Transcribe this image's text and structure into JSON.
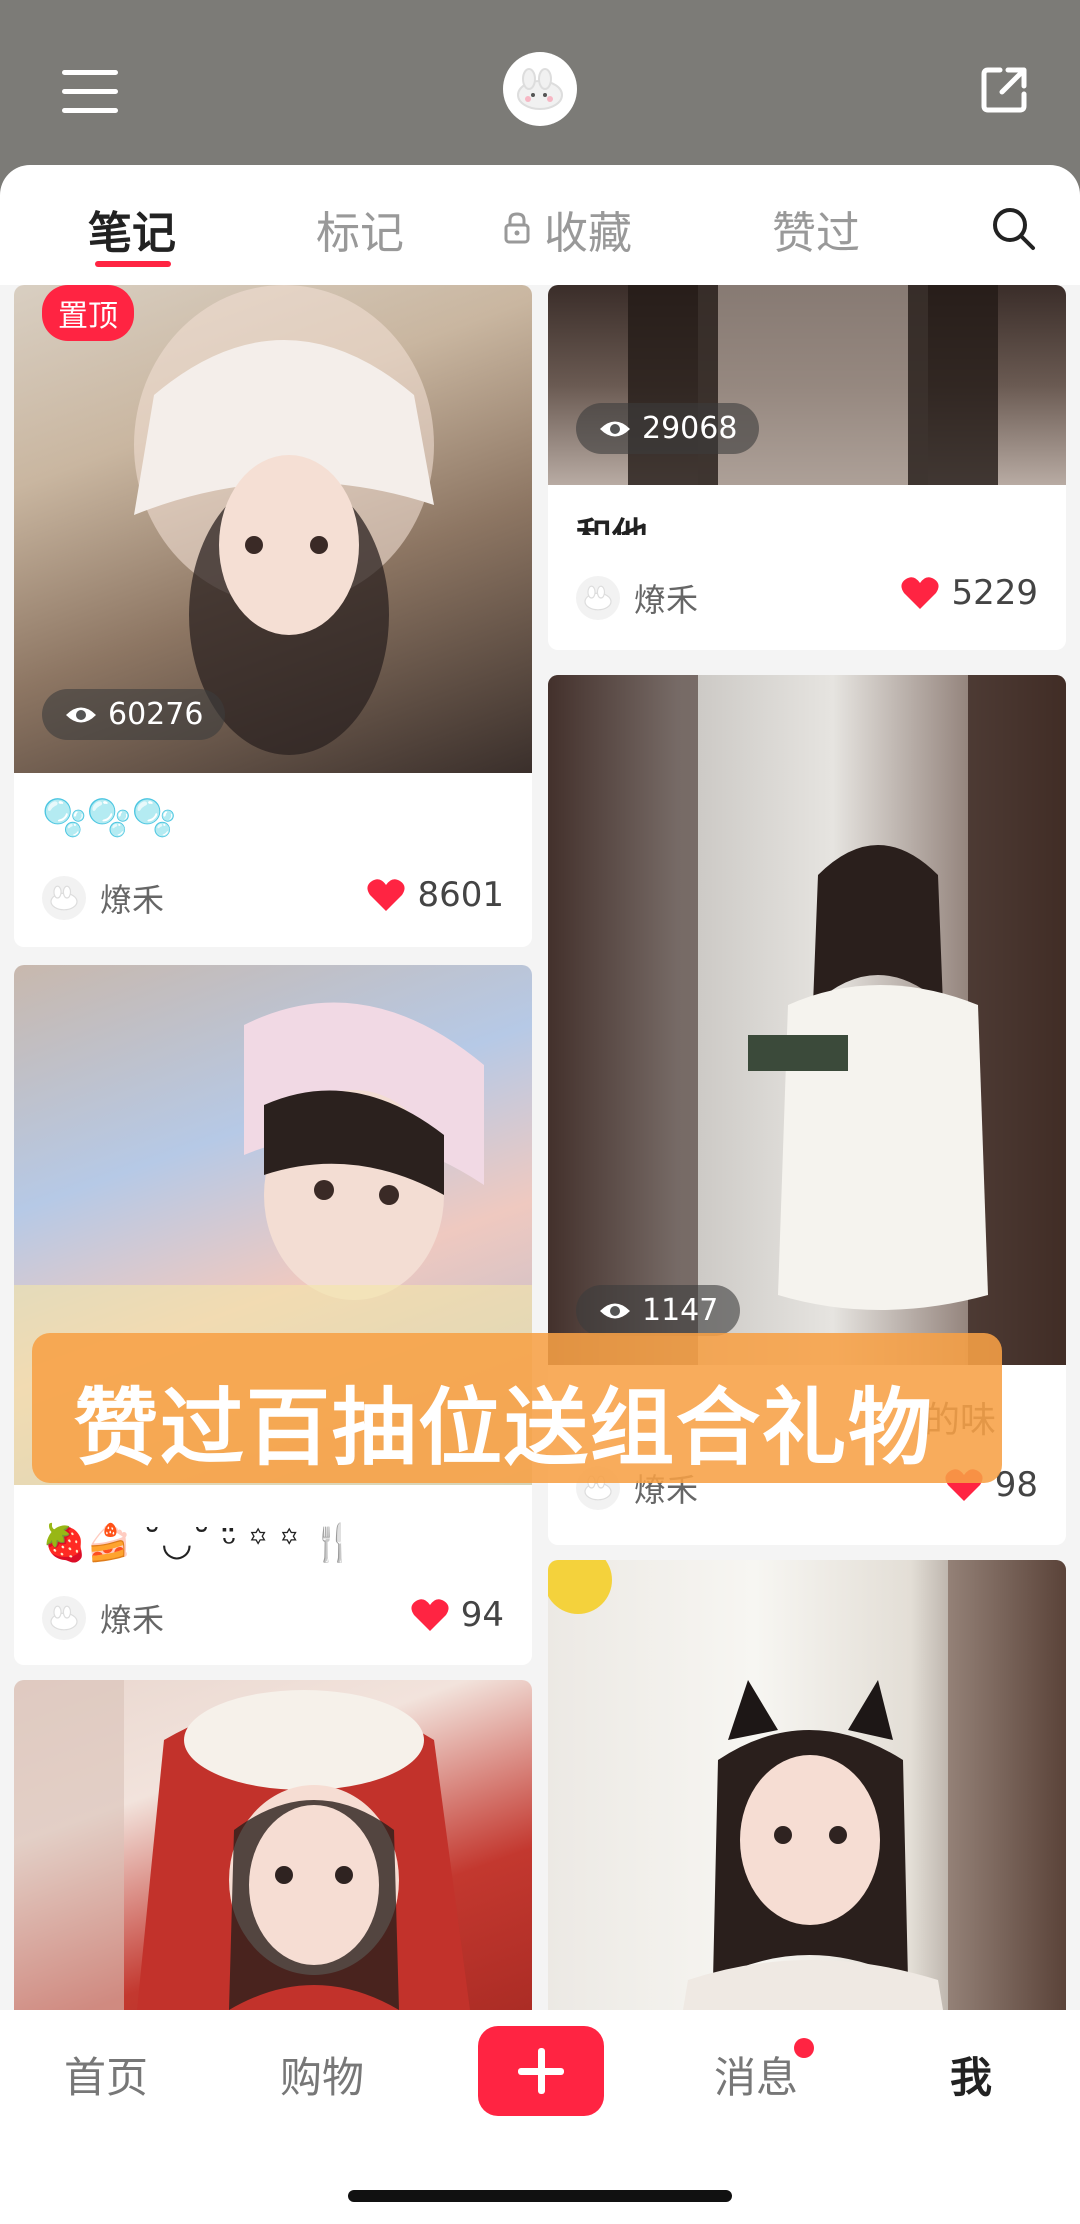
{
  "header": {
    "menu_icon": "hamburger-icon",
    "avatar_icon": "bunny-avatar-icon",
    "share_icon": "share-external-icon"
  },
  "tabs": [
    {
      "label": "笔记",
      "active": true
    },
    {
      "label": "标记",
      "active": false
    },
    {
      "label": "收藏",
      "active": false,
      "icon": "lock-icon"
    },
    {
      "label": "赞过",
      "active": false
    }
  ],
  "search_icon": "search-icon",
  "cards": [
    {
      "pinned_label": "置顶",
      "views": "60276",
      "title": "🫧🫧🫧",
      "author": "燎禾",
      "likes": "8601"
    },
    {
      "views": "29068",
      "title": "和他",
      "author": "燎禾",
      "likes": "5229"
    },
    {
      "title": "🍓🍰 ˘◡˘ ᵕ̈ ꙳ ꙳ 🍴",
      "author": "燎禾",
      "likes": "94"
    },
    {
      "views": "1147",
      "title": "的味",
      "author": "燎禾",
      "likes": "98"
    },
    {},
    {}
  ],
  "overlay_banner": "赞过百抽位送组合礼物",
  "bottom_nav": [
    {
      "label": "首页",
      "active": false
    },
    {
      "label": "购物",
      "active": false
    },
    {
      "label": "",
      "icon": "plus-icon"
    },
    {
      "label": "消息",
      "active": false,
      "badge": true
    },
    {
      "label": "我",
      "active": true
    }
  ],
  "colors": {
    "accent": "#ff2442",
    "topbar": "#7c7b77",
    "banner": "#f7a046"
  }
}
